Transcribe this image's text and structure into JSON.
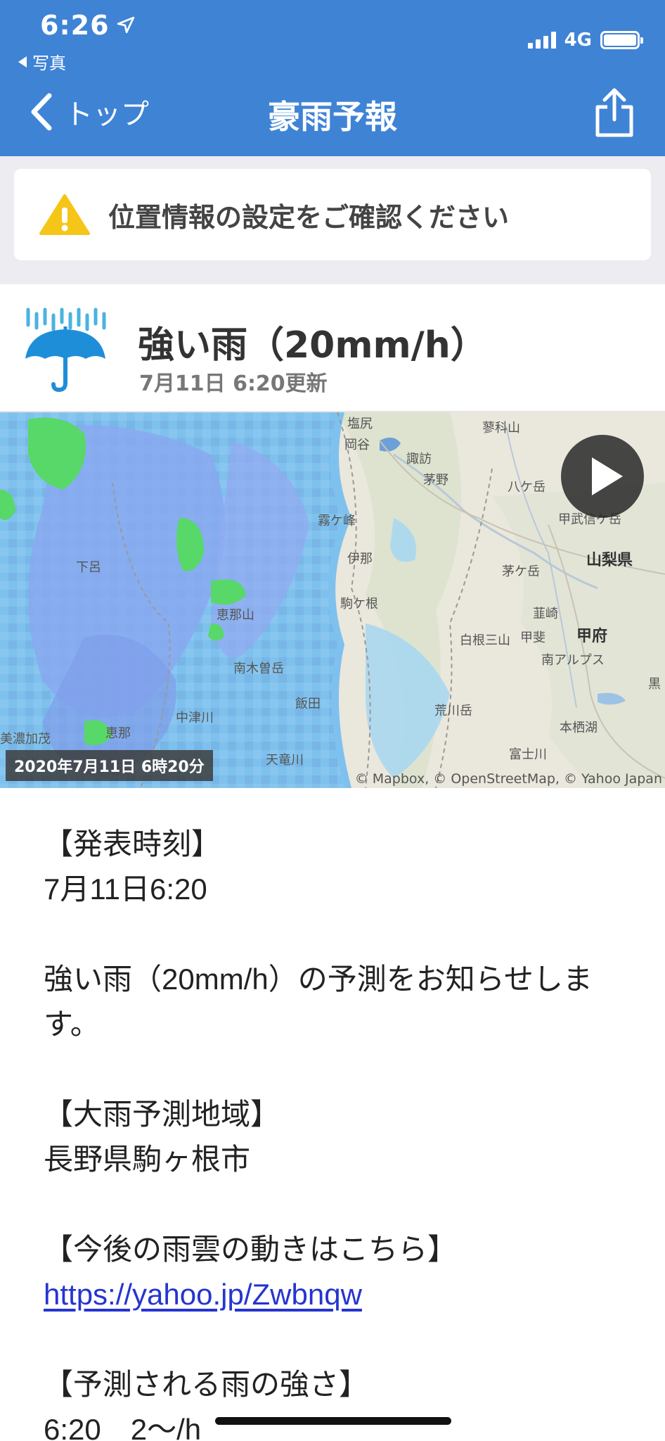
{
  "status_bar": {
    "time": "6:26",
    "back_app": "写真",
    "network": "4G",
    "battery_level": 1.0
  },
  "nav": {
    "back_label": "トップ",
    "title": "豪雨予報"
  },
  "notice": {
    "text": "位置情報の設定をご確認ください"
  },
  "alert": {
    "title": "強い雨（20mm/h）",
    "updated": "7月11日 6:20更新"
  },
  "map": {
    "timestamp": "2020年7月11日 6時20分",
    "credit": "© Mapbox, © OpenStreetMap, © Yahoo Japan",
    "labels": [
      "塩尻",
      "岡谷",
      "諏訪",
      "茅野",
      "霧ケ峰",
      "蓼科山",
      "八ケ岳",
      "甲武信ケ岳",
      "伊那",
      "山梨県",
      "茅ケ岳",
      "駒ケ根",
      "韮崎",
      "白根三山",
      "甲斐",
      "甲府",
      "南アルプス",
      "黒",
      "下呂",
      "恵那山",
      "南木曽岳",
      "荒川岳",
      "中津川",
      "飯田",
      "本栖湖",
      "美濃加茂",
      "恵那",
      "天竜川",
      "富士川"
    ]
  },
  "body": {
    "issued_heading": "【発表時刻】",
    "issued_value": "7月11日6:20",
    "message": "強い雨（20mm/h）の予測をお知らせします。",
    "area_heading": "【大雨予測地域】",
    "area_value": "長野県駒ヶ根市",
    "link_heading": "【今後の雨雲の動きはこちら】",
    "link": "https://yahoo.jp/Zwbnqw",
    "intensity_heading": "【予測される雨の強さ】",
    "intensity_partial": "6:20　2～/h"
  },
  "colors": {
    "header_blue": "#3f83d5",
    "link_blue": "#2435d0",
    "warning_yellow": "#f5c518"
  }
}
